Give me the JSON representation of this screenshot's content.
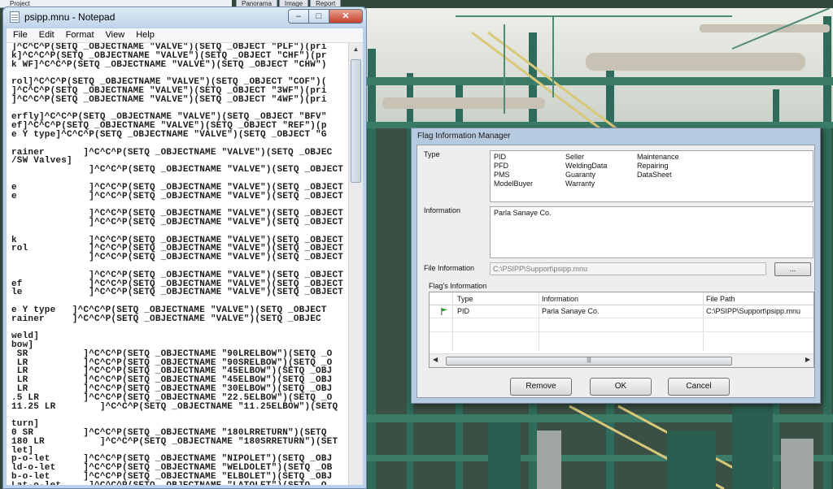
{
  "host": {
    "project_label": "Project",
    "tabs": [
      "Panorama",
      "Image",
      "Report"
    ]
  },
  "notepad": {
    "title": "psipp.mnu - Notepad",
    "menu": [
      "File",
      "Edit",
      "Format",
      "View",
      "Help"
    ],
    "lines": [
      "]^C^C^P(SETQ _OBJECTNAME \"VALVE\")(SETQ _OBJECT \"PLF\")(pri",
      "k]^C^C^P(SETQ _OBJECTNAME \"VALVE\")(SETQ _OBJECT \"CHF\")(pr",
      "k WF]^C^C^P(SETQ _OBJECTNAME \"VALVE\")(SETQ _OBJECT \"CHW\")",
      "",
      "rol]^C^C^P(SETQ _OBJECTNAME \"VALVE\")(SETQ _OBJECT \"COF\")(",
      "]^C^C^P(SETQ _OBJECTNAME \"VALVE\")(SETQ _OBJECT \"3WF\")(pri",
      "]^C^C^P(SETQ _OBJECTNAME \"VALVE\")(SETQ _OBJECT \"4WF\")(pri",
      "",
      "erfly]^C^C^P(SETQ _OBJECTNAME \"VALVE\")(SETQ _OBJECT \"BFV\"",
      "ef]^C^C^P(SETQ _OBJECTNAME \"VALVE\")(SETQ _OBJECT \"REF\")(p",
      "e Y type]^C^C^P(SETQ _OBJECTNAME \"VALVE\")(SETQ _OBJECT \"G",
      "",
      "rainer       ]^C^C^P(SETQ _OBJECTNAME \"VALVE\")(SETQ _OBJEC",
      "/SW Valves]",
      "              ]^C^C^P(SETQ _OBJECTNAME \"VALVE\")(SETQ _OBJECT",
      "",
      "e             ]^C^C^P(SETQ _OBJECTNAME \"VALVE\")(SETQ _OBJECT",
      "e             ]^C^C^P(SETQ _OBJECTNAME \"VALVE\")(SETQ _OBJECT",
      "",
      "              ]^C^C^P(SETQ _OBJECTNAME \"VALVE\")(SETQ _OBJECT",
      "              ]^C^C^P(SETQ _OBJECTNAME \"VALVE\")(SETQ _OBJECT",
      "",
      "k             ]^C^C^P(SETQ _OBJECTNAME \"VALVE\")(SETQ _OBJECT",
      "rol           ]^C^C^P(SETQ _OBJECTNAME \"VALVE\")(SETQ _OBJECT",
      "              ]^C^C^P(SETQ _OBJECTNAME \"VALVE\")(SETQ _OBJECT",
      "",
      "              ]^C^C^P(SETQ _OBJECTNAME \"VALVE\")(SETQ _OBJECT",
      "ef            ]^C^C^P(SETQ _OBJECTNAME \"VALVE\")(SETQ _OBJECT",
      "le            ]^C^C^P(SETQ _OBJECTNAME \"VALVE\")(SETQ _OBJECT",
      "",
      "e Y type   ]^C^C^P(SETQ _OBJECTNAME \"VALVE\")(SETQ _OBJECT",
      "rainer     ]^C^C^P(SETQ _OBJECTNAME \"VALVE\")(SETQ _OBJEC",
      "",
      "weld]",
      "bow]",
      " SR          ]^C^C^P(SETQ _OBJECTNAME \"90LRELBOW\")(SETQ _O",
      " LR          ]^C^C^P(SETQ _OBJECTNAME \"90SRELBOW\")(SETQ _O",
      " LR          ]^C^C^P(SETQ _OBJECTNAME \"45ELBOW\")(SETQ _OBJ",
      " LR          ]^C^C^P(SETQ _OBJECTNAME \"45ELBOW\")(SETQ _OBJ",
      " LR          ]^C^C^P(SETQ _OBJECTNAME \"30ELBOW\")(SETQ _OBJ",
      ".5 LR        ]^C^C^P(SETQ _OBJECTNAME \"22.5ELBOW\")(SETQ _O",
      "11.25 LR        ]^C^C^P(SETQ _OBJECTNAME \"11.25ELBOW\")(SETQ",
      "",
      "turn]",
      "0 SR         ]^C^C^P(SETQ _OBJECTNAME \"180LRRETURN\")(SETQ",
      "180 LR          ]^C^C^P(SETQ _OBJECTNAME \"180SRRETURN\")(SET",
      "let]",
      "p-o-let      ]^C^C^P(SETQ _OBJECTNAME \"NIPOLET\")(SETQ _OBJ",
      "ld-o-let     ]^C^C^P(SETQ _OBJECTNAME \"WELDOLET\")(SETQ _OB",
      "b-o-let      ]^C^C^P(SETQ _OBJECTNAME \"ELBOLET\")(SETQ _OBJ",
      "Lat-o-let     ]^C^C^P(SETQ _OBJECTNAME \"LATOLET\")(SETQ _O",
      "",
      "e]"
    ]
  },
  "dialog": {
    "title": "Flag Information Manager",
    "type_label": "Type",
    "type_options": {
      "col1": [
        "PID",
        "PFD",
        "PMS",
        "ModelBuyer"
      ],
      "col2": [
        "Seller",
        "WeldingData",
        "Guaranty",
        "Warranty"
      ],
      "col3": [
        "Maintenance",
        "Repairing",
        "DataSheet"
      ]
    },
    "information_label": "Information",
    "information_value": "Parla Sanaye Co.",
    "file_info_label": "File Information",
    "file_info_value": "C:\\PSIPP\\Support\\psipp.mnu",
    "browse_label": "...",
    "flags_label": "Flag's Information",
    "columns": [
      "Type",
      "Information",
      "File Path"
    ],
    "rows": [
      {
        "type": "PID",
        "information": "Parla Sanaye Co.",
        "file_path": "C:\\PSIPP\\Support\\psipp.mnu"
      }
    ],
    "buttons": {
      "remove": "Remove",
      "ok": "OK",
      "cancel": "Cancel"
    },
    "colors": {
      "flag": "#2e9a2e"
    }
  }
}
